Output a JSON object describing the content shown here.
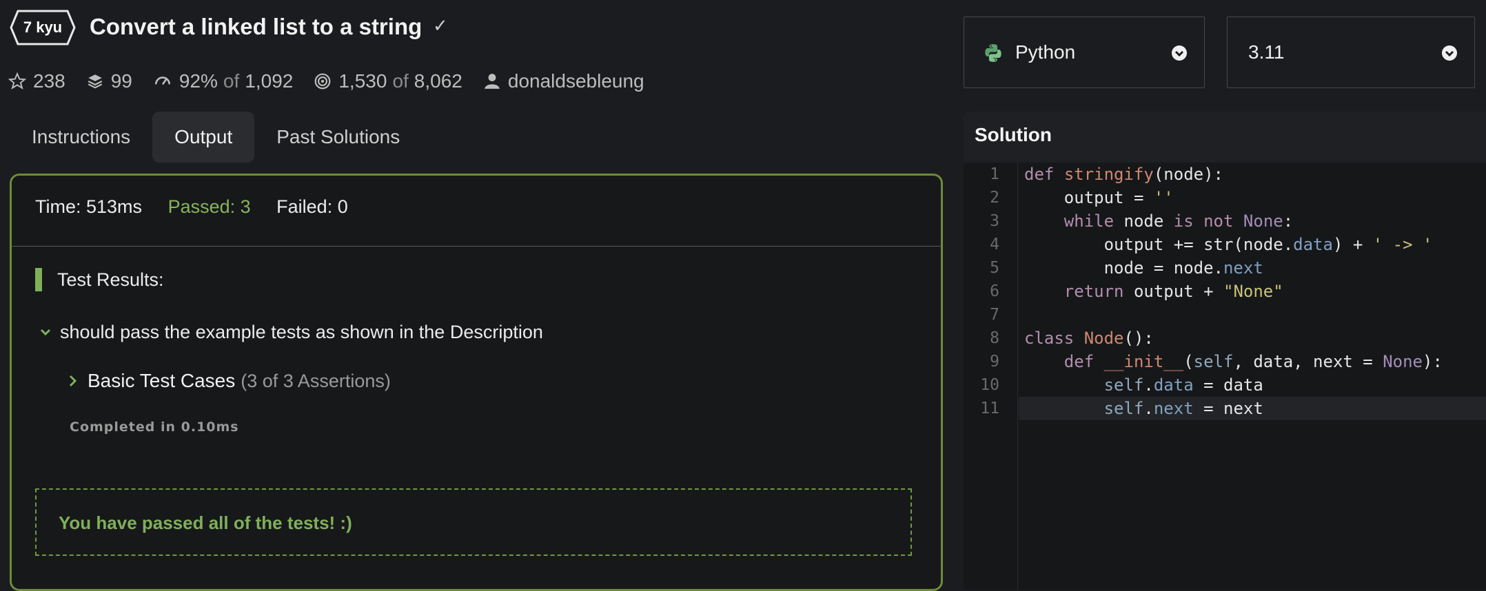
{
  "kata": {
    "rank": "7 kyu",
    "title": "Convert a linked list to a string"
  },
  "stats": {
    "stars": "238",
    "collections": "99",
    "satisfaction": "92%",
    "satisfaction_of": "of",
    "votes": "1,092",
    "completed": "1,530",
    "completed_of": "of",
    "attempts": "8,062",
    "author": "donaldsebleung"
  },
  "tabs": [
    {
      "label": "Instructions",
      "active": false
    },
    {
      "label": "Output",
      "active": true
    },
    {
      "label": "Past Solutions",
      "active": false
    }
  ],
  "output": {
    "time": "Time: 513ms",
    "passed": "Passed: 3",
    "failed": "Failed: 0",
    "results_title": "Test Results:",
    "describe": "should pass the example tests as shown in the Description",
    "it_label": "Basic Test Cases",
    "it_count": "(3 of 3 Assertions)",
    "completed": "Completed in 0.10ms",
    "passed_message": "You have passed all of the tests! :)"
  },
  "language_select": {
    "value": "Python",
    "icon": "python-icon"
  },
  "version_select": {
    "value": "3.11"
  },
  "solution": {
    "heading": "Solution",
    "line_numbers": [
      "1",
      "2",
      "3",
      "4",
      "5",
      "6",
      "7",
      "8",
      "9",
      "10",
      "11"
    ]
  },
  "colors": {
    "background": "#1b1c1f",
    "pass_green": "#7fb05a",
    "panel_border": "#6f8a3a"
  }
}
